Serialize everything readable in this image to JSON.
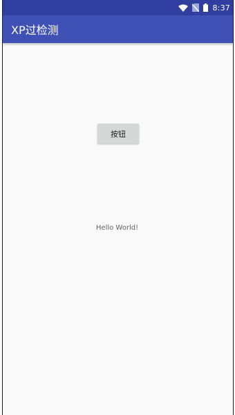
{
  "status_bar": {
    "time": "8:37",
    "icons": [
      "wifi-icon",
      "no-sim-icon",
      "battery-icon"
    ]
  },
  "app_bar": {
    "title": "XP过检测"
  },
  "main": {
    "button_label": "按钮",
    "hello_text": "Hello World!"
  },
  "colors": {
    "status_bar": "#303f9f",
    "app_bar": "#3f51b5",
    "background": "#fafafa",
    "button": "#d6d7d7"
  }
}
